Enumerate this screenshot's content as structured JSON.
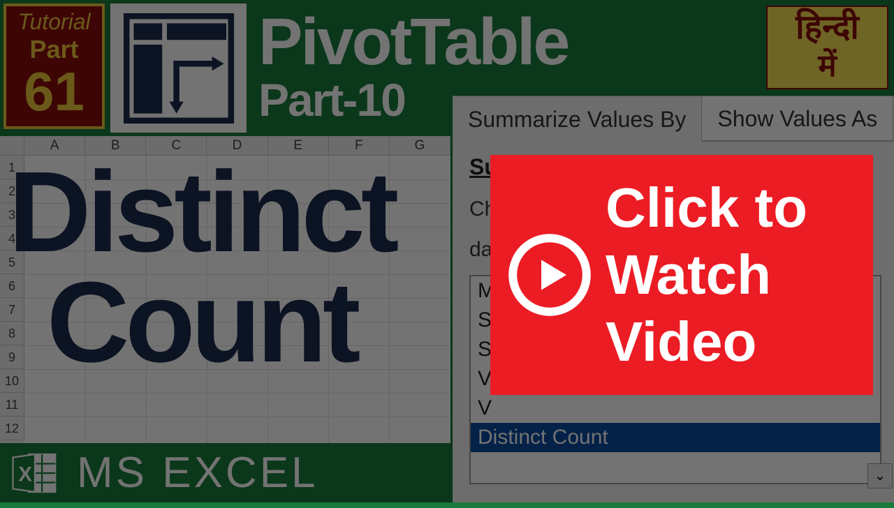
{
  "badge": {
    "line1": "Tutorial",
    "line2": "Part",
    "line3": "61"
  },
  "title": {
    "main": "PivotTable",
    "sub": "Part-10"
  },
  "hindi": {
    "l1": "हिन्दी",
    "l2": "में"
  },
  "sheet": {
    "cols": [
      "A",
      "B",
      "C",
      "D",
      "E",
      "F",
      "G"
    ],
    "rows": [
      "1",
      "2",
      "3",
      "4",
      "5",
      "6",
      "7",
      "8",
      "9",
      "10",
      "11",
      "12"
    ]
  },
  "headline": {
    "l1": "Distinct",
    "l2": "Count"
  },
  "footer": {
    "label": "MS EXCEL"
  },
  "dialog": {
    "tabs": {
      "active": "Summarize Values By",
      "inactive": "Show Values As"
    },
    "group": "Su",
    "help_l1": "Ch",
    "help_l2": "da",
    "options": [
      "M",
      "St",
      "St",
      "V",
      "V",
      "Distinct Count"
    ]
  },
  "cta": {
    "text": "Click to\nWatch\nVideo"
  }
}
